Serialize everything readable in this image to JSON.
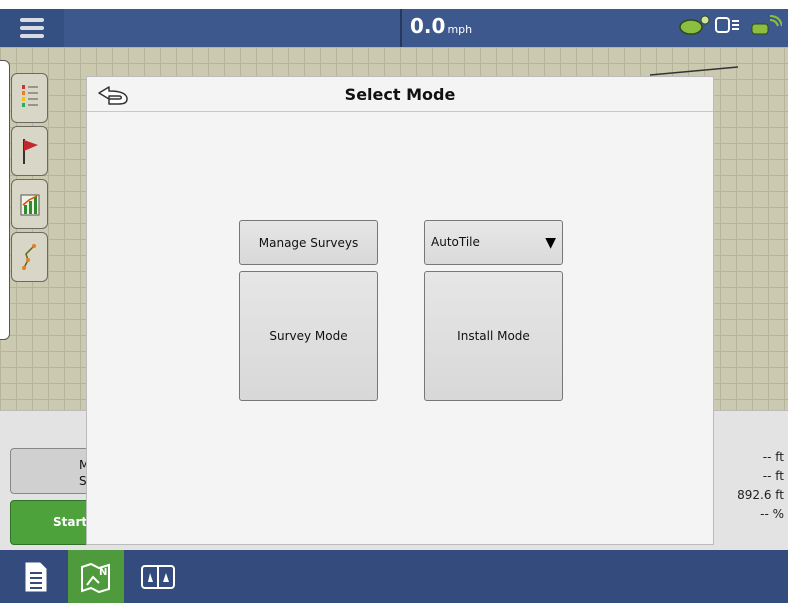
{
  "topbar": {
    "speed_value": "0.0",
    "speed_unit": "mph",
    "icons": [
      "gps-status-icon",
      "display-icon",
      "satellite-signal-icon"
    ]
  },
  "modal": {
    "title": "Select Mode",
    "manage_surveys_label": "Manage Surveys",
    "survey_mode_label": "Survey Mode",
    "install_mode_label": "Install Mode",
    "dropdown_value": "AutoTile",
    "dropdown_arrow": "▼"
  },
  "lower_panel": {
    "button_partial_line1": "M",
    "button_partial_line2": "S",
    "start_partial": "Start",
    "stats": [
      "-- ft",
      "-- ft",
      "892.6 ft",
      "-- %"
    ]
  },
  "left_tools": [
    "legend-icon",
    "flag-icon",
    "chart-icon",
    "path-icon"
  ],
  "bottom_nav": [
    "report-icon",
    "map-north-icon",
    "split-view-icon"
  ],
  "colors": {
    "topbar": "#3d588c",
    "active_nav": "#4e9a3c",
    "start_button": "#4ea23c",
    "map_background": "#ccc9b1"
  }
}
